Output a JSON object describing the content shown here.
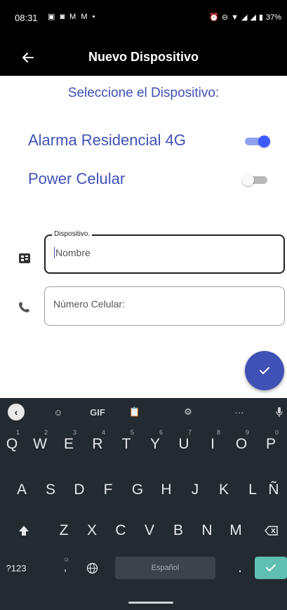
{
  "status_bar": {
    "time": "08:31",
    "notification_icons": "▣ ◙ M M •",
    "battery": "37%"
  },
  "app_bar": {
    "back_icon": "arrow-back",
    "title": "Nuevo Dispositivo"
  },
  "select_label": "Seleccione el Dispositivo:",
  "options": [
    {
      "label": "Alarma Residencial 4G",
      "enabled": true
    },
    {
      "label": "Power Celular",
      "enabled": false
    }
  ],
  "fields": {
    "device": {
      "legend": "Dispositivo.",
      "placeholder": "Nombre",
      "icon": "device-id-icon"
    },
    "phone": {
      "placeholder": "Número Celular:",
      "icon": "phone-icon"
    }
  },
  "fab": {
    "icon": "check-icon"
  },
  "keyboard": {
    "toolbar": {
      "gif_label": "GIF",
      "more_label": "···"
    },
    "row1": [
      {
        "key": "Q",
        "hint": "1"
      },
      {
        "key": "W",
        "hint": "2"
      },
      {
        "key": "E",
        "hint": "3"
      },
      {
        "key": "R",
        "hint": "4"
      },
      {
        "key": "T",
        "hint": "5"
      },
      {
        "key": "Y",
        "hint": "6"
      },
      {
        "key": "U",
        "hint": "7"
      },
      {
        "key": "I",
        "hint": "8"
      },
      {
        "key": "O",
        "hint": "9"
      },
      {
        "key": "P",
        "hint": "0"
      }
    ],
    "row2": [
      "A",
      "S",
      "D",
      "F",
      "G",
      "H",
      "J",
      "K",
      "L",
      "Ñ"
    ],
    "row3": [
      "Z",
      "X",
      "C",
      "V",
      "B",
      "N",
      "M"
    ],
    "numbers_label": "?123",
    "space_label": "Español",
    "period_label": ".",
    "comma_label": ",",
    "colors": {
      "background": "#232a30",
      "enter": "#5fbfb0"
    }
  },
  "colors": {
    "accent": "#3F51B5",
    "switch_on": "#3D5AFE"
  }
}
